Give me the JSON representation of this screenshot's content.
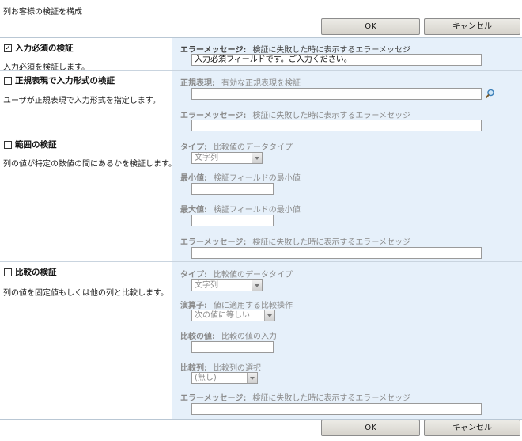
{
  "page": {
    "title": "列お客様の検証を構成"
  },
  "buttons": {
    "ok": "OK",
    "cancel": "キャンセル"
  },
  "sections": {
    "required": {
      "title": "入力必須の検証",
      "checked": true,
      "check_mark": "✓",
      "description": "入力必須を検証します。",
      "error_label": "エラーメッセージ:",
      "error_hint": "検証に失敗した時に表示するエラーメッセジ",
      "error_value": "入力必須フィールドです。ご入力ください。"
    },
    "regex": {
      "title": "正規表現で入力形式の検証",
      "checked": false,
      "description": "ユーザが正規表現で入力形式を指定します。",
      "regex_label": "正規表現:",
      "regex_hint": "有効な正規表現を検証",
      "regex_value": "",
      "error_label": "エラーメッセージ:",
      "error_hint": "検証に失敗した時に表示するエラーメセッジ",
      "error_value": "",
      "lookup_icon": "magnifier-icon"
    },
    "range": {
      "title": "範囲の検証",
      "checked": false,
      "description": "列の値が特定の数値の間にあるかを検証します。",
      "type_label": "タイプ:",
      "type_hint": "比較値のデータタイプ",
      "type_value": "文字列",
      "min_label": "最小値:",
      "min_hint": "検証フィールドの最小値",
      "min_value": "",
      "max_label": "最大値:",
      "max_hint": "検証フィールドの最小値",
      "max_value": "",
      "error_label": "エラーメッセージ:",
      "error_hint": "検証に失敗した時に表示するエラーメセッジ",
      "error_value": ""
    },
    "compare": {
      "title": "比較の検証",
      "checked": false,
      "description": "列の値を固定値もしくは他の列と比較します。",
      "type_label": "タイプ:",
      "type_hint": "比較値のデータタイプ",
      "type_value": "文字列",
      "operator_label": "演算子:",
      "operator_hint": "値に適用する比較操作",
      "operator_value": "次の値に等しい",
      "value_label": "比較の値:",
      "value_hint": "比較の値の入力",
      "value_value": "",
      "column_label": "比較列:",
      "column_hint": "比較列の選択",
      "column_value": "(無し)",
      "error_label": "エラーメッセージ:",
      "error_hint": "検証に失敗した時に表示するエラーメセッジ",
      "error_value": ""
    }
  }
}
